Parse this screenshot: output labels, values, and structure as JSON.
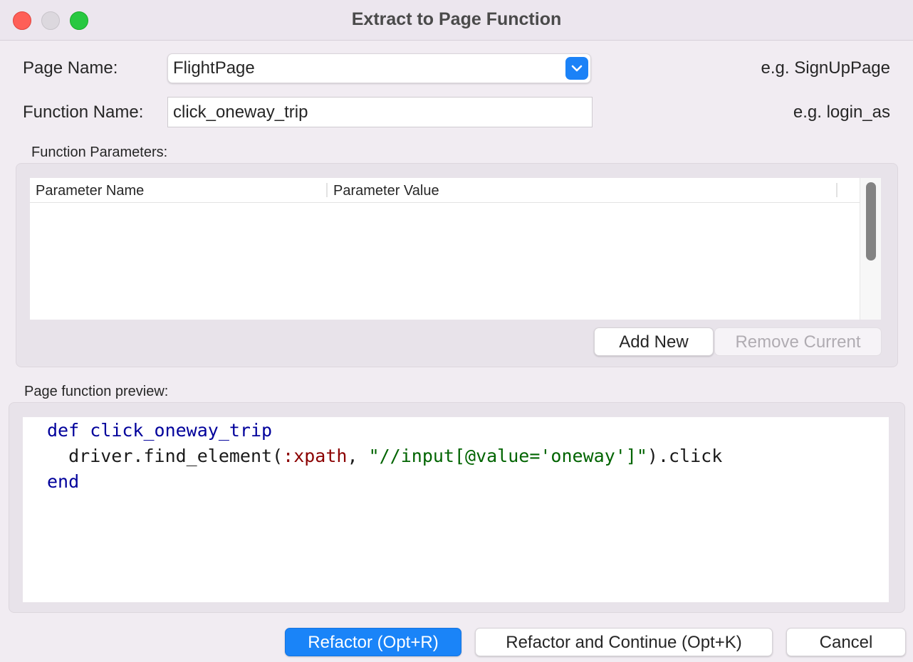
{
  "window": {
    "title": "Extract to Page Function"
  },
  "form": {
    "page_name_label": "Page Name:",
    "page_name_value": "FlightPage",
    "page_name_hint": "e.g. SignUpPage",
    "function_name_label": "Function Name:",
    "function_name_value": "click_oneway_trip",
    "function_name_hint": "e.g. login_as"
  },
  "parameters": {
    "section_label": "Function Parameters:",
    "columns": [
      "Parameter Name",
      "Parameter Value"
    ],
    "rows": [],
    "add_button": "Add New",
    "remove_button": "Remove Current"
  },
  "preview": {
    "section_label": "Page function preview:",
    "line1_keyword": "def",
    "line1_name": "click_oneway_trip",
    "line2_prefix": "  driver.find_element(",
    "line2_symbol": ":xpath",
    "line2_sep": ", ",
    "line2_string": "\"//input[@value='oneway']\"",
    "line2_suffix": ").click",
    "line3_keyword": "end"
  },
  "footer": {
    "refactor_button": "Refactor (Opt+R)",
    "refactor_continue_button": "Refactor and Continue (Opt+K)",
    "cancel_button": "Cancel"
  },
  "colors": {
    "accent": "#1a84f8",
    "close": "#fe5f57",
    "maximize": "#28c840",
    "keyword": "#00009b",
    "symbol": "#8b0000",
    "string": "#006400"
  }
}
